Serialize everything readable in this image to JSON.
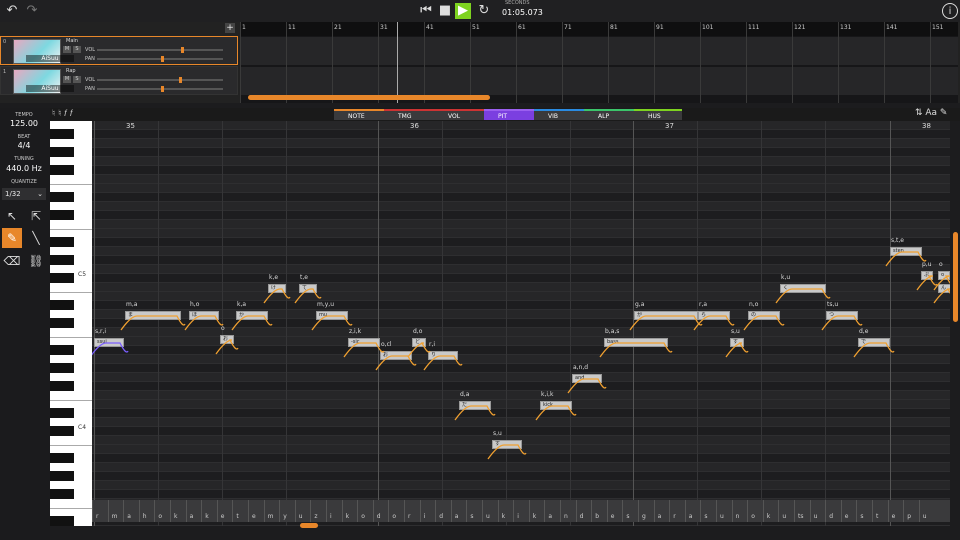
{
  "transport": {
    "time_label": "SECONDS",
    "time": "01:05.073"
  },
  "tracks": [
    {
      "num": "0",
      "avatar": "AiSuu",
      "name": "Main",
      "vol": "VOL",
      "pan": "PAN",
      "m": "M",
      "s": "S"
    },
    {
      "num": "1",
      "avatar": "AiSuu",
      "name": "Rap",
      "vol": "VOL",
      "pan": "PAN",
      "m": "M",
      "s": "S"
    }
  ],
  "ruler": [
    "1",
    "11",
    "21",
    "31",
    "41",
    "51",
    "61",
    "71",
    "81",
    "91",
    "101",
    "111",
    "121",
    "131",
    "141",
    "151"
  ],
  "tabs": [
    "NOTE",
    "TMG",
    "VOL",
    "PIT",
    "VIB",
    "ALP",
    "HUS"
  ],
  "left": {
    "tempo_label": "TEMPO",
    "tempo": "125.00",
    "beat_label": "BEAT",
    "beat": "4/4",
    "tuning_label": "TUNING",
    "tuning": "440.0 Hz",
    "quantize_label": "QUANTIZE",
    "quantize": "1/32"
  },
  "keys": [
    "C5",
    "C4"
  ],
  "bars": [
    "35",
    "36",
    "37",
    "38"
  ],
  "notes": [
    {
      "s": "s,r,i",
      "t": "ssui"
    },
    {
      "s": "m,a",
      "t": "ま"
    },
    {
      "s": "h,o",
      "t": "ほ"
    },
    {
      "s": "o",
      "t": "お"
    },
    {
      "s": "k,a",
      "t": "か"
    },
    {
      "s": "k,e",
      "t": "け"
    },
    {
      "s": "t,e",
      "t": "て"
    },
    {
      "s": "m,y,u",
      "t": "mu"
    },
    {
      "s": "z,i,k",
      "t": "-sic"
    },
    {
      "s": "o,cl",
      "t": "お"
    },
    {
      "s": "d,o",
      "t": "ど"
    },
    {
      "s": "r,i",
      "t": "り"
    },
    {
      "s": "d,a",
      "t": "だ"
    },
    {
      "s": "s,u",
      "t": "す"
    },
    {
      "s": "k,i,k",
      "t": "kick"
    },
    {
      "s": "a,n,d",
      "t": "and"
    },
    {
      "s": "b,a,s",
      "t": "bass"
    },
    {
      "s": "g,a",
      "t": "が"
    },
    {
      "s": "r,a",
      "t": "ら"
    },
    {
      "s": "s,u",
      "t": "す"
    },
    {
      "s": "n,o",
      "t": "の"
    },
    {
      "s": "k,u",
      "t": "く"
    },
    {
      "s": "ts,u",
      "t": "つ"
    },
    {
      "s": "d,e",
      "t": "で"
    },
    {
      "s": "s,t,e",
      "t": "sten"
    },
    {
      "s": "p,u",
      "t": "ぷ"
    },
    {
      "s": "o",
      "t": "o"
    },
    {
      "s": "n",
      "t": "ん"
    }
  ],
  "phonemes": [
    "r",
    "m",
    "a",
    "h",
    "o",
    "k",
    "a",
    "k",
    "e",
    "t",
    "e",
    "m",
    "y",
    "u",
    "z",
    "i",
    "k",
    "o",
    "d",
    "o",
    "r",
    "i",
    "d",
    "a",
    "s",
    "u",
    "k",
    "i",
    "k",
    "a",
    "n",
    "d",
    "b",
    "e",
    "s",
    "g",
    "a",
    "r",
    "a",
    "s",
    "u",
    "n",
    "o",
    "k",
    "u",
    "ts",
    "u",
    "d",
    "e",
    "s",
    "t",
    "e",
    "p",
    "u"
  ]
}
